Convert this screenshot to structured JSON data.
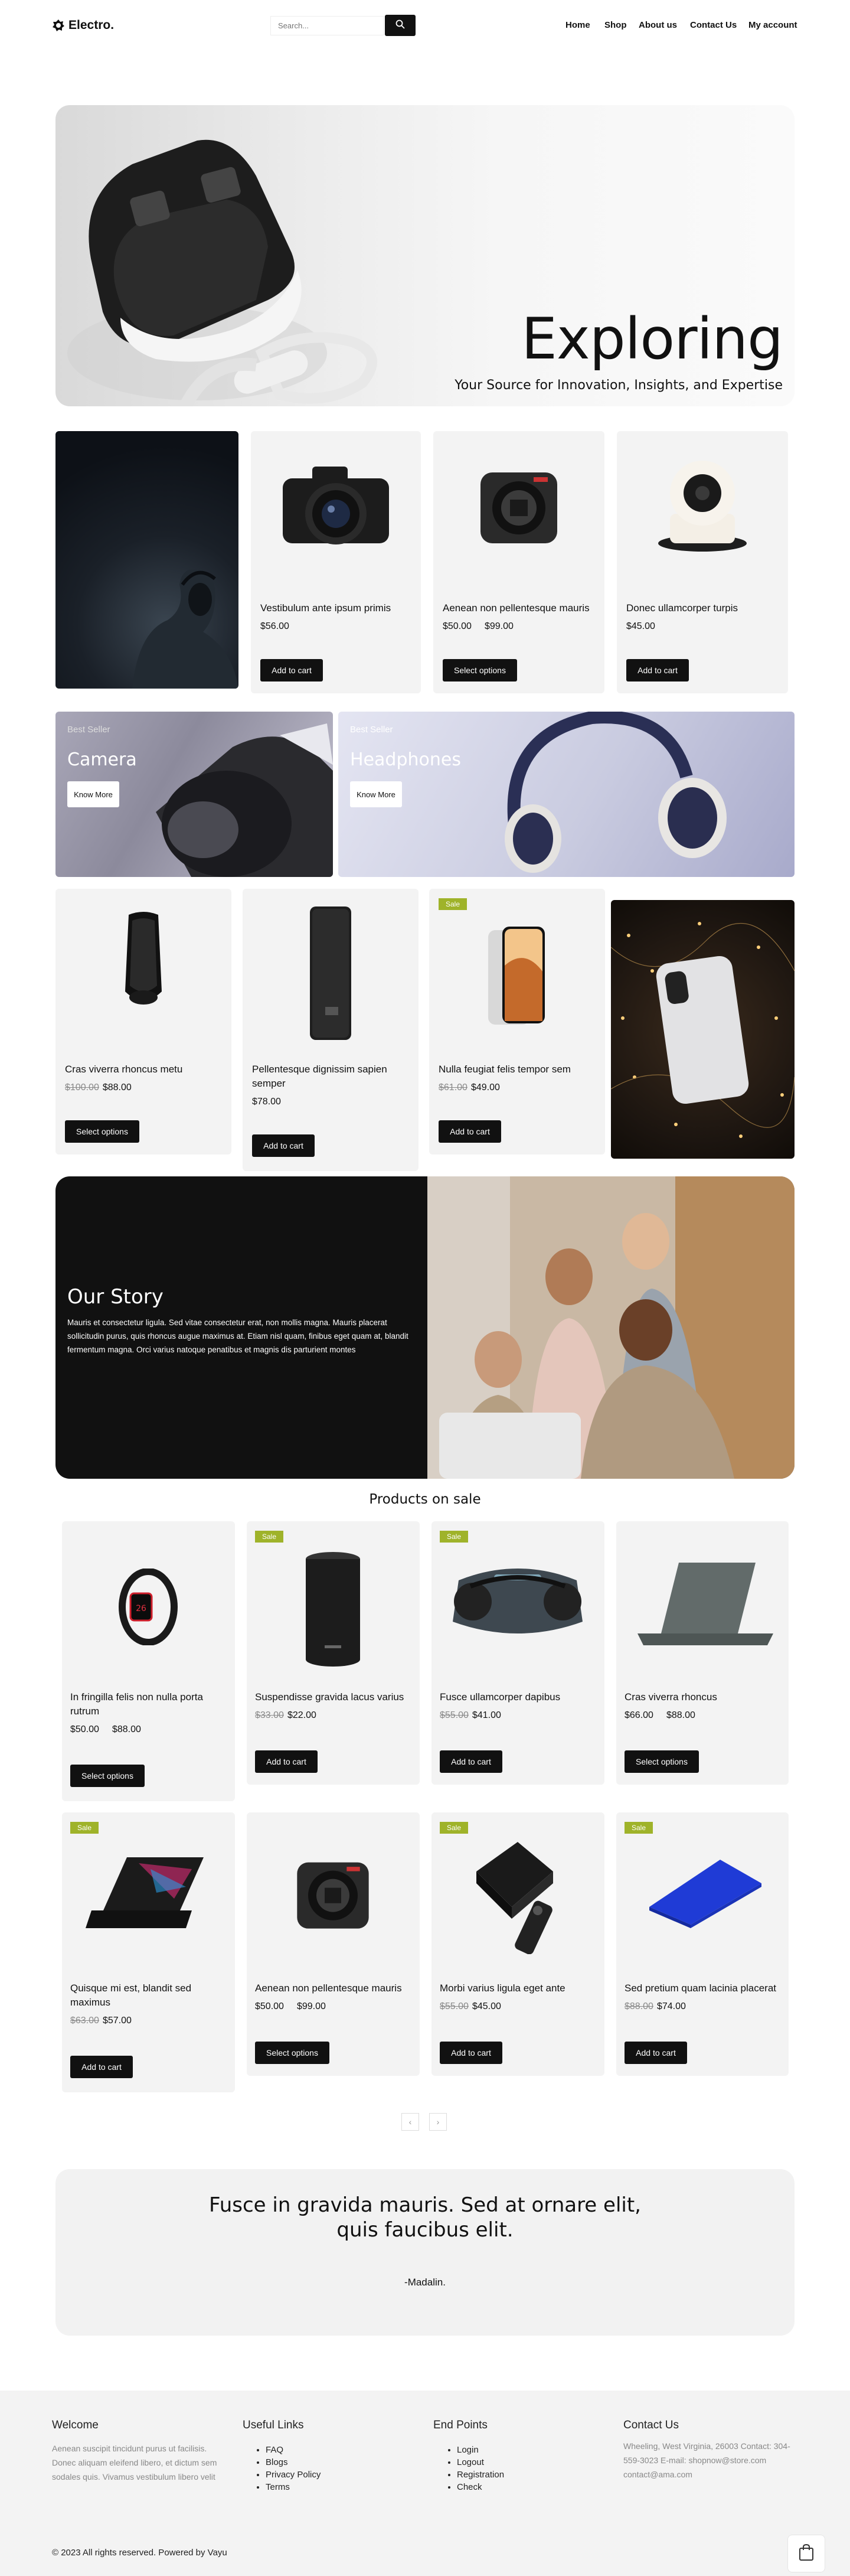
{
  "header": {
    "logo": "Electro.",
    "search_placeholder": "Search...",
    "nav": [
      "Home",
      "Shop",
      "About us",
      "Contact Us",
      "My account"
    ]
  },
  "hero": {
    "title": "Exploring",
    "subtitle": "Your Source for Innovation, Insights, and Expertise"
  },
  "row1": [
    {
      "title": "Vestibulum ante ipsum primis",
      "price": "$56.00",
      "button": "Add to cart",
      "image": "dslr-camera"
    },
    {
      "title": "Aenean non pellentesque mauris",
      "price_min": "$50.00",
      "price_max": "$99.00",
      "button": "Select options",
      "image": "camera-body"
    },
    {
      "title": "Donec ullamcorper turpis",
      "price": "$45.00",
      "button": "Add to cart",
      "image": "security-camera"
    }
  ],
  "banners": [
    {
      "label": "Best Seller",
      "title": "Camera",
      "button": "Know More"
    },
    {
      "label": "Best Seller",
      "title": "Headphones",
      "button": "Know More"
    }
  ],
  "row2": [
    {
      "title": "Cras viverra rhoncus metu",
      "old_price": "$100.00",
      "price": "$88.00",
      "button": "Select options",
      "image": "folding-phone"
    },
    {
      "title": "Pellentesque dignissim sapien semper",
      "price": "$78.00",
      "button": "Add to cart",
      "image": "power-bank"
    },
    {
      "title": "Nulla feugiat felis tempor sem",
      "old_price": "$61.00",
      "price": "$49.00",
      "button": "Add to cart",
      "sale": "Sale",
      "image": "smartphone"
    }
  ],
  "story": {
    "title": "Our Story",
    "text": "Mauris et consectetur ligula. Sed vitae consectetur erat, non mollis magna. Mauris placerat sollicitudin purus, quis rhoncus augue maximus at. Etiam nisl quam, finibus eget quam at, blandit fermentum magna. Orci varius natoque penatibus et magnis dis parturient montes"
  },
  "sale_section": {
    "heading": "Products on sale",
    "products": [
      {
        "title": "In fringilla felis non nulla porta rutrum",
        "price_min": "$50.00",
        "price_max": "$88.00",
        "button": "Select options",
        "image": "smartwatch"
      },
      {
        "title": "Suspendisse gravida lacus varius",
        "old_price": "$33.00",
        "price": "$22.00",
        "button": "Add to cart",
        "sale": "Sale",
        "image": "speaker-cylinder"
      },
      {
        "title": "Fusce ullamcorper dapibus",
        "old_price": "$55.00",
        "price": "$41.00",
        "button": "Add to cart",
        "sale": "Sale",
        "image": "speaker-boombox"
      },
      {
        "title": "Cras viverra rhoncus",
        "price_min": "$66.00",
        "price_max": "$88.00",
        "button": "Select options",
        "image": "laptop-gray"
      },
      {
        "title": "Quisque mi est, blandit sed maximus",
        "old_price": "$63.00",
        "price": "$57.00",
        "button": "Add to cart",
        "sale": "Sale",
        "image": "laptop-gaming"
      },
      {
        "title": "Aenean non pellentesque mauris",
        "price_min": "$50.00",
        "price_max": "$99.00",
        "button": "Select options",
        "image": "camera-body"
      },
      {
        "title": "Morbi varius ligula eget ante",
        "old_price": "$55.00",
        "price": "$45.00",
        "button": "Add to cart",
        "sale": "Sale",
        "image": "tv-box"
      },
      {
        "title": "Sed pretium quam lacinia placerat",
        "old_price": "$88.00",
        "price": "$74.00",
        "button": "Add to cart",
        "sale": "Sale",
        "image": "laptop-blue"
      }
    ],
    "pagination": [
      "‹",
      "›"
    ]
  },
  "testimonial": {
    "quote": "Fusce in gravida mauris. Sed at ornare elit, quis faucibus elit.",
    "author": "-Madalin."
  },
  "footer": {
    "welcome_title": "Welcome",
    "welcome_text": "Aenean suscipit tincidunt purus ut facilisis. Donec aliquam eleifend libero, et dictum sem sodales quis. Vivamus vestibulum libero velit",
    "links_title": "Useful Links",
    "links": [
      "FAQ",
      "Blogs",
      "Privacy Policy",
      "Terms"
    ],
    "endpoints_title": "End Points",
    "endpoints": [
      "Login",
      "Logout",
      "Registration",
      "Check"
    ],
    "contact_title": "Contact Us",
    "contact_text": "Wheeling, West Virginia, 26003 Contact: 304-559-3023 E-mail: shopnow@store.com contact@ama.com",
    "copyright": "© 2023 All rights reserved. Powered by Vayu"
  },
  "colors": {
    "sale_badge": "#9fb32a",
    "button": "#111111",
    "card": "#f3f3f3",
    "story_bg": "#111111"
  }
}
